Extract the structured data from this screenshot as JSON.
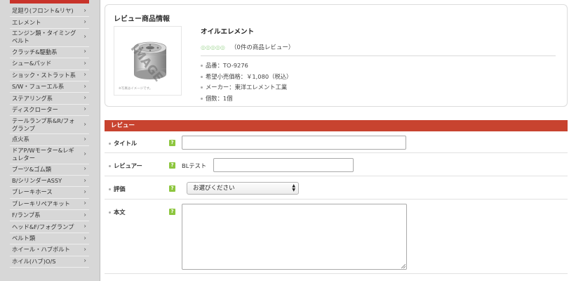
{
  "sidebar": {
    "items": [
      {
        "label": "足廻り(フロント&リヤ)",
        "lines": 1
      },
      {
        "label": "エレメント",
        "lines": 1
      },
      {
        "label": "エンジン類・タイミングベルト",
        "lines": 2
      },
      {
        "label": "クラッチ&駆動系",
        "lines": 1
      },
      {
        "label": "シュー&パッド",
        "lines": 1
      },
      {
        "label": "ショック・ストラット系",
        "lines": 1
      },
      {
        "label": "S/W・フューエル系",
        "lines": 1
      },
      {
        "label": "ステアリング系",
        "lines": 1
      },
      {
        "label": "ディスクローター",
        "lines": 1
      },
      {
        "label": "テールランプ系&R/フォグランプ",
        "lines": 2
      },
      {
        "label": "点火系",
        "lines": 1
      },
      {
        "label": "ドアP/Wモーター&レギュレター",
        "lines": 2
      },
      {
        "label": "ブーツ&ゴム類",
        "lines": 1
      },
      {
        "label": "B/シリンダーASSY",
        "lines": 1
      },
      {
        "label": "ブレーキホース",
        "lines": 1
      },
      {
        "label": "ブレーキリペアキット",
        "lines": 1
      },
      {
        "label": "F/ランプ系",
        "lines": 1
      },
      {
        "label": "ヘッド&F/フォグランプ",
        "lines": 1
      },
      {
        "label": "ベルト類",
        "lines": 1
      },
      {
        "label": "ホイール・ハブボルト",
        "lines": 1
      },
      {
        "label": "ホイル(ハブ)O/S",
        "lines": 1
      }
    ],
    "chevron": "›"
  },
  "product": {
    "section_title": "レビュー商品情報",
    "name": "オイルエレメント",
    "stars": "◎◎◎◎◎",
    "review_count": "（0件の商品レビュー）",
    "image_watermark": "IMAGE",
    "image_note": "※写真はイメージです。",
    "specs": [
      "品番：TO-9276",
      "希望小売価格：￥1,080（税込）",
      "メーカー：東洋エレメント工業",
      "個数：1個"
    ]
  },
  "review": {
    "header": "レビュー",
    "help_glyph": "?",
    "fields": {
      "title_label": "タイトル",
      "reviewer_label": "レビュアー",
      "reviewer_prefix": "BLテスト",
      "rating_label": "評価",
      "rating_selected": "お選びください",
      "body_label": "本文"
    }
  },
  "colors": {
    "accent_red": "#c8432f",
    "help_green": "#8dc63f",
    "star_green": "#a6d99a",
    "sidebar_bg": "#d7d7d7"
  }
}
